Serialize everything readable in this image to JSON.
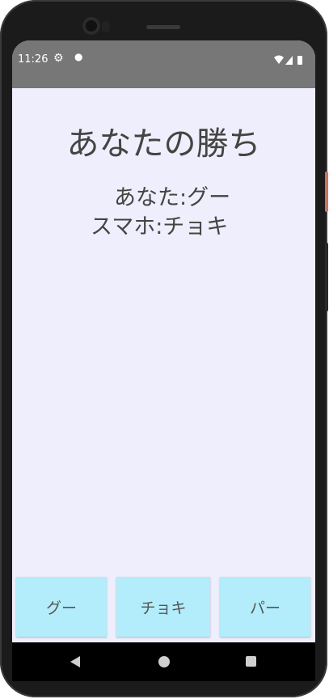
{
  "status": {
    "time": "11:26",
    "icons": [
      "gear-icon",
      "dot-icon",
      "wifi-icon",
      "signal-icon",
      "battery-icon"
    ]
  },
  "main": {
    "result": "あなたの勝ち",
    "player_choice": "あなた:グー",
    "phone_choice": "スマホ:チョキ"
  },
  "buttons": {
    "gu": "グー",
    "choki": "チョキ",
    "pa": "パー"
  },
  "colors": {
    "background": "#efeefc",
    "statusbar": "#777777",
    "button": "#b3edfb"
  }
}
